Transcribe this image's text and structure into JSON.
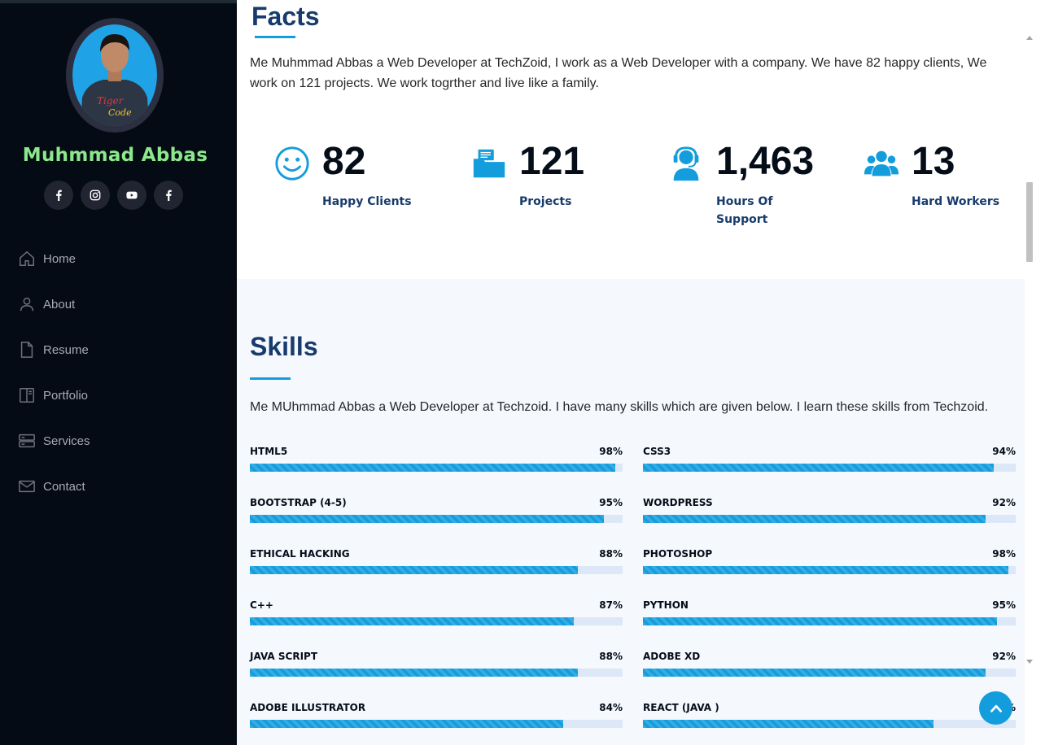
{
  "sidebar": {
    "profile_name": "Muhmmad Abbas",
    "avatar_text": [
      "Tiger",
      "Code"
    ],
    "social": [
      {
        "icon": "facebook-icon"
      },
      {
        "icon": "instagram-icon"
      },
      {
        "icon": "youtube-icon"
      },
      {
        "icon": "facebook-icon"
      }
    ],
    "nav": [
      {
        "label": "Home",
        "icon": "home-icon"
      },
      {
        "label": "About",
        "icon": "person-icon"
      },
      {
        "label": "Resume",
        "icon": "file-icon"
      },
      {
        "label": "Portfolio",
        "icon": "book-half-icon"
      },
      {
        "label": "Services",
        "icon": "server-icon"
      },
      {
        "label": "Contact",
        "icon": "envelope-icon"
      }
    ]
  },
  "facts": {
    "title": "Facts",
    "description": "Me Muhmmad Abbas a Web Developer at TechZoid, I work as a Web Developer with a company. We have 82 happy clients, We work on 121 projects. We work togrther and live like a family.",
    "items": [
      {
        "count": "82",
        "label": "Happy Clients",
        "icon": "emoji-smile-icon"
      },
      {
        "count": "121",
        "label": "Projects",
        "icon": "journal-richtext-icon"
      },
      {
        "count": "1,463",
        "label": "Hours Of Support",
        "icon": "headset-icon"
      },
      {
        "count": "13",
        "label": "Hard Workers",
        "icon": "people-icon"
      }
    ]
  },
  "skills": {
    "title": "Skills",
    "description": "Me MUhmmad Abbas a Web Developer at Techzoid. I have many skills which are given below. I learn these skills from Techzoid.",
    "items": [
      {
        "name": "HTML5",
        "percent": "98%",
        "value": 98
      },
      {
        "name": "CSS3",
        "percent": "94%",
        "value": 94
      },
      {
        "name": "BOOTSTRAP (4-5)",
        "percent": "95%",
        "value": 95
      },
      {
        "name": "WORDPRESS",
        "percent": "92%",
        "value": 92
      },
      {
        "name": "ETHICAL HACKING",
        "percent": "88%",
        "value": 88
      },
      {
        "name": "PHOTOSHOP",
        "percent": "98%",
        "value": 98
      },
      {
        "name": "C++",
        "percent": "87%",
        "value": 87
      },
      {
        "name": "PYTHON",
        "percent": "95%",
        "value": 95
      },
      {
        "name": "JAVA SCRIPT",
        "percent": "88%",
        "value": 88
      },
      {
        "name": "ADOBE XD",
        "percent": "92%",
        "value": 92
      },
      {
        "name": "ADOBE ILLUSTRATOR",
        "percent": "84%",
        "value": 84
      },
      {
        "name": "REACT (JAVA )",
        "percent": "78%",
        "value": 78
      }
    ]
  },
  "colors": {
    "accent": "#149ddd",
    "heading": "#173b6c",
    "sidebar_bg": "#040b14",
    "name_color": "#8be88b"
  }
}
